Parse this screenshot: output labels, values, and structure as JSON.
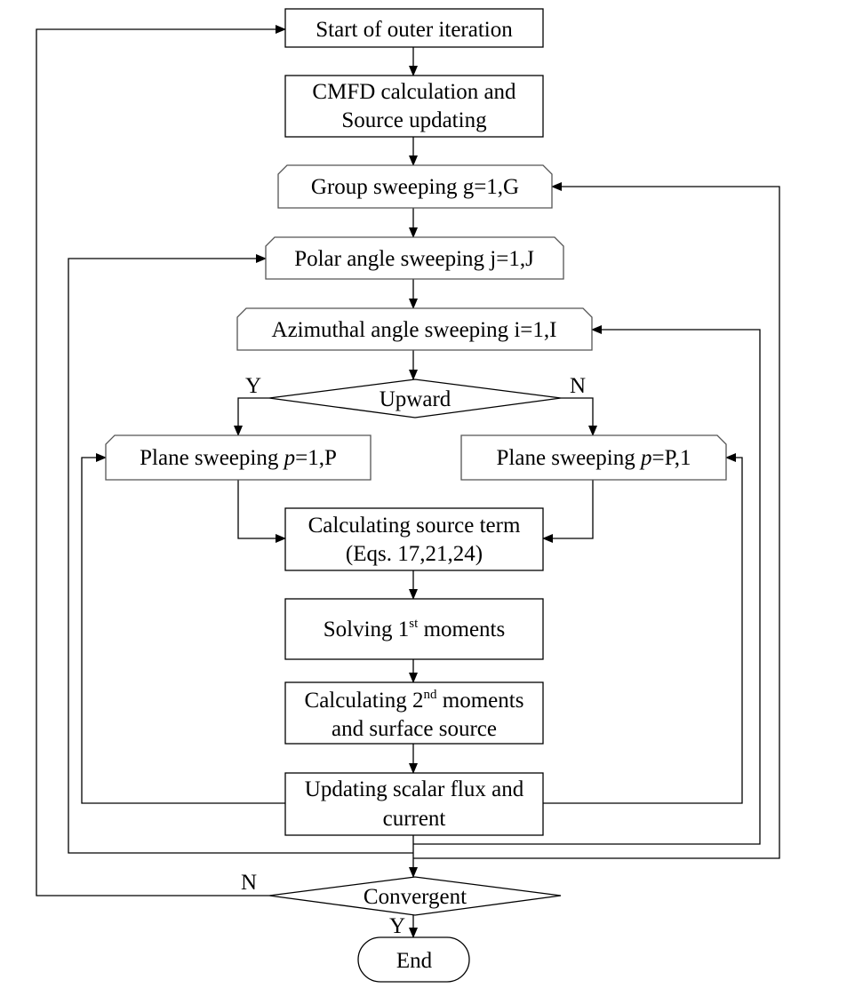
{
  "nodes": {
    "start": "Start of outer iteration",
    "cmfd_1": "CMFD calculation and",
    "cmfd_2": "Source updating",
    "group": "Group sweeping g=1,G",
    "polar": "Polar angle sweeping j=1,J",
    "azimuthal": "Azimuthal angle sweeping i=1,I",
    "upward": "Upward",
    "plane_left_prefix": "Plane sweeping ",
    "plane_left_var": "p",
    "plane_left_suffix": "=1,P",
    "plane_right_prefix": "Plane sweeping ",
    "plane_right_var": "p",
    "plane_right_suffix": "=P,1",
    "source_1": "Calculating source term",
    "source_2": "(Eqs. 17,21,24)",
    "first_pre": "Solving 1",
    "first_sup": "st",
    "first_post": " moments",
    "second_pre": "Calculating 2",
    "second_sup": "nd",
    "second_post": " moments",
    "second_2": "and surface source",
    "update_1": "Updating scalar flux and",
    "update_2": "current",
    "convergent": "Convergent",
    "end": "End"
  },
  "labels": {
    "upward_yes": "Y",
    "upward_no": "N",
    "conv_no": "N",
    "conv_yes": "Y"
  }
}
